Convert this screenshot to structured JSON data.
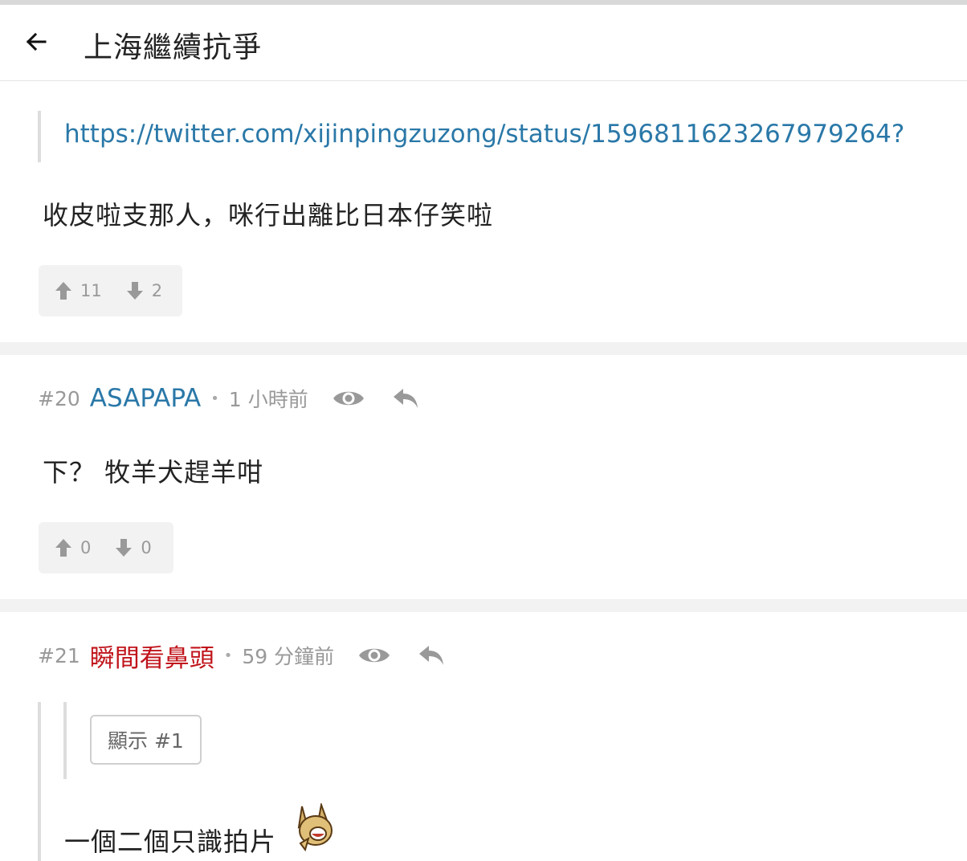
{
  "header": {
    "title": "上海繼續抗爭"
  },
  "posts": [
    {
      "quote_link": "https://twitter.com/xijinpingzuzong/status/1596811623267979264?",
      "body": "收皮啦支那人，咪行出離比日本仔笑啦",
      "votes": {
        "up": "11",
        "down": "2"
      }
    },
    {
      "number": "#20",
      "username": "ASAPAPA",
      "username_color": "#2a78a8",
      "separator": "•",
      "time": "1 小時前",
      "body": "下？ 牧羊犬趕羊咁",
      "votes": {
        "up": "0",
        "down": "0"
      }
    },
    {
      "number": "#21",
      "username": "瞬間看鼻頭",
      "username_color": "#c0141b",
      "separator": "•",
      "time": "59 分鐘前",
      "show_quote_label": "顯示 #1",
      "body": "一個二個只識拍片"
    }
  ],
  "icons": {
    "back": "arrow-left-icon",
    "upvote": "arrow-up-icon",
    "downvote": "arrow-down-icon",
    "view": "eye-icon",
    "reply": "reply-icon",
    "emoji": "laughing-dog-sticker"
  },
  "colors": {
    "link": "#2a78a8",
    "muted": "#999999",
    "separator_band": "#f2f2f2"
  }
}
